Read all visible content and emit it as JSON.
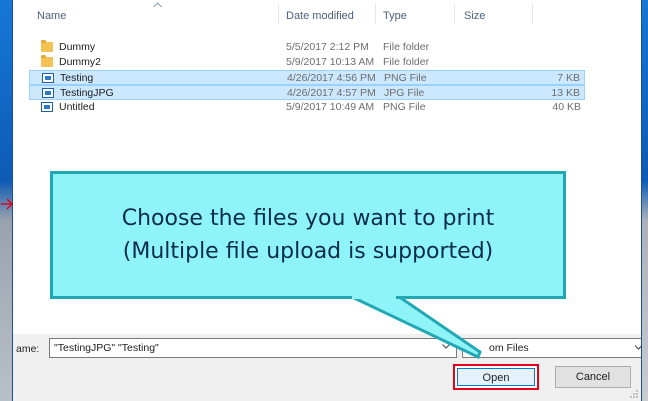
{
  "columns": {
    "name": "Name",
    "date": "Date modified",
    "type": "Type",
    "size": "Size"
  },
  "files": [
    {
      "name": "Dummy",
      "date": "5/5/2017 2:12 PM",
      "type": "File folder",
      "size": "",
      "icon": "folder-icon",
      "selected": false
    },
    {
      "name": "Dummy2",
      "date": "5/9/2017 10:13 AM",
      "type": "File folder",
      "size": "",
      "icon": "folder-icon",
      "selected": false
    },
    {
      "name": "Testing",
      "date": "4/26/2017 4:56 PM",
      "type": "PNG File",
      "size": "7 KB",
      "icon": "image-file-icon",
      "selected": true
    },
    {
      "name": "TestingJPG",
      "date": "4/26/2017 4:57 PM",
      "type": "JPG File",
      "size": "13 KB",
      "icon": "image-file-icon",
      "selected": true
    },
    {
      "name": "Untitled",
      "date": "5/9/2017 10:49 AM",
      "type": "PNG File",
      "size": "40 KB",
      "icon": "image-file-icon",
      "selected": false
    }
  ],
  "callout": {
    "line1": "Choose the files you want to print",
    "line2": "(Multiple file upload is supported)"
  },
  "bottom": {
    "filename_label": "ame:",
    "filename_value": "\"TestingJPG\" \"Testing\"",
    "filter_value": "om Files",
    "open_label": "Open",
    "cancel_label": "Cancel"
  },
  "colors": {
    "callout_fill": "#8ff4f8",
    "callout_border": "#22a8b4",
    "highlight_red": "#e4001c",
    "selection": "#cce8ff"
  }
}
